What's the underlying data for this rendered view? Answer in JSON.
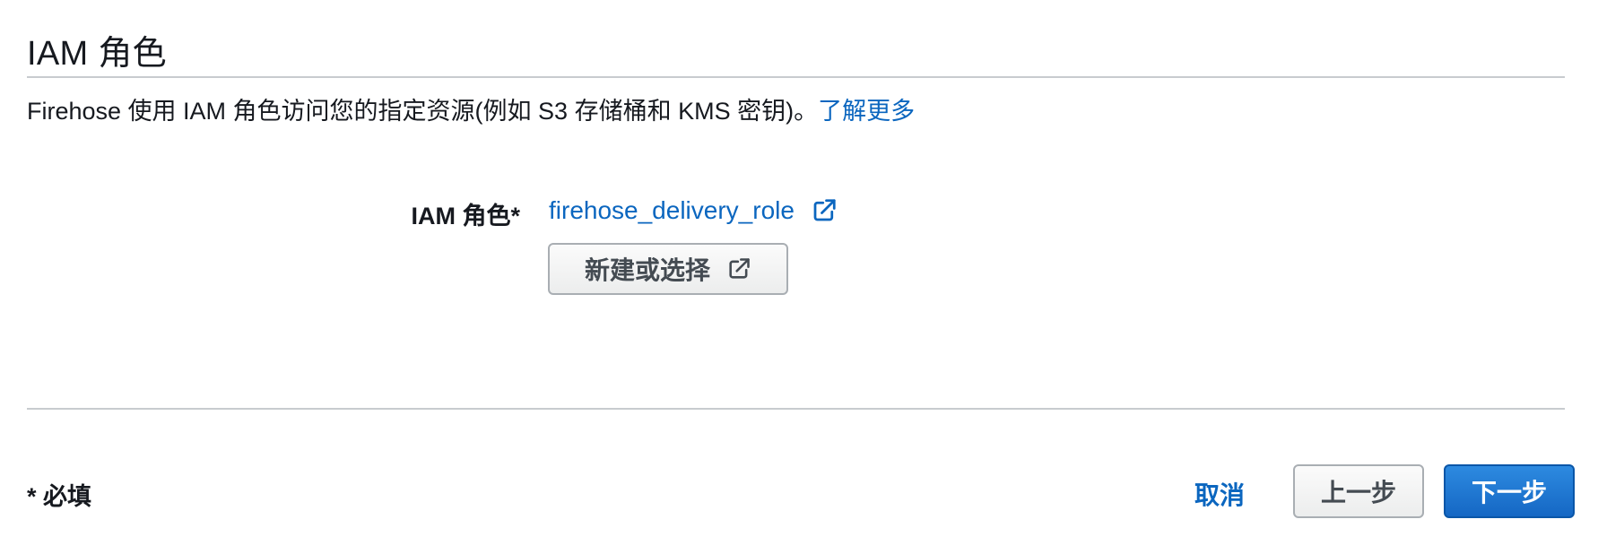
{
  "section": {
    "title": "IAM 角色",
    "description_text": "Firehose 使用 IAM 角色访问您的指定资源(例如 S3 存储桶和 KMS 密钥)。",
    "learn_more_label": "了解更多"
  },
  "iam_role_field": {
    "label": "IAM 角色*",
    "selected_role": "firehose_delivery_role",
    "link_icon": "external-link-icon",
    "new_or_select_label": "新建或选择",
    "button_icon": "external-link-icon"
  },
  "footer": {
    "required_note": "* 必填",
    "cancel_label": "取消",
    "previous_label": "上一步",
    "next_label": "下一步"
  },
  "colors": {
    "link": "#0b66bf",
    "primary_button": "#1567c4",
    "text": "#16191f",
    "divider": "#c8cbcf"
  }
}
